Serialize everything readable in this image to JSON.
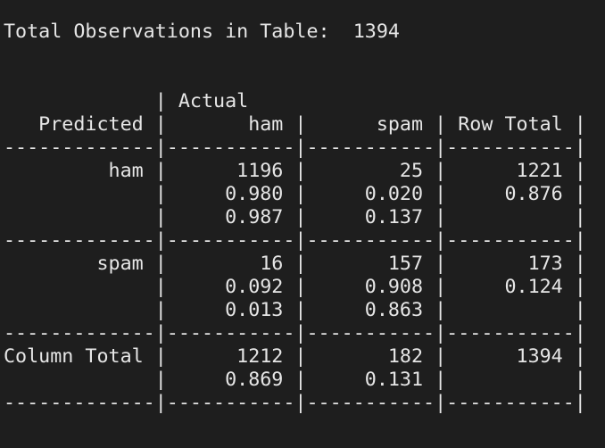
{
  "terminal": {
    "background": "#1e1e1e",
    "foreground": "#e6e6e6",
    "summary": "Total Observations in Table:  1394",
    "table_lines": [
      "             | Actual ",
      "   Predicted |       ham |      spam | Row Total | ",
      "-------------|-----------|-----------|-----------|",
      "         ham |      1196 |        25 |      1221 | ",
      "             |     0.980 |     0.020 |     0.876 | ",
      "             |     0.987 |     0.137 |           | ",
      "-------------|-----------|-----------|-----------|",
      "        spam |        16 |       157 |       173 | ",
      "             |     0.092 |     0.908 |     0.124 | ",
      "             |     0.013 |     0.863 |           | ",
      "-------------|-----------|-----------|-----------|",
      "Column Total |      1212 |       182 |      1394 | ",
      "             |     0.869 |     0.131 |           | ",
      "-------------|-----------|-----------|-----------|"
    ]
  }
}
